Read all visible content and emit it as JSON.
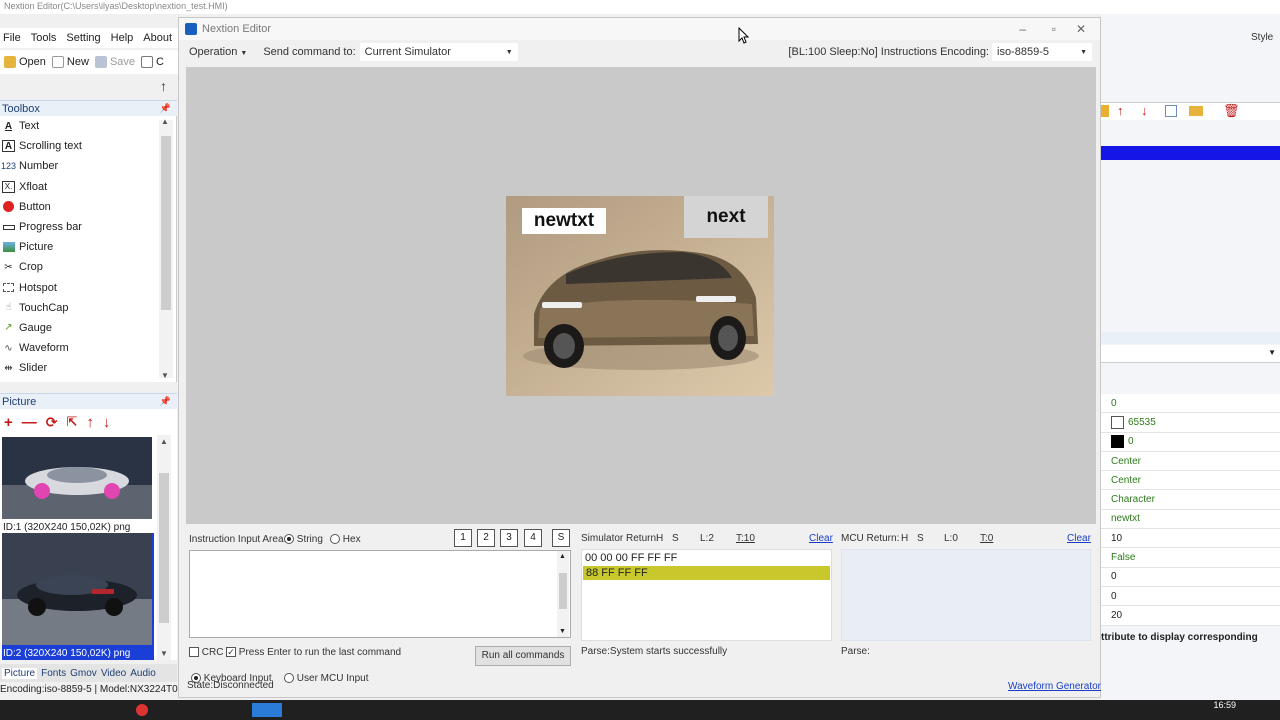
{
  "app_title_bar": {
    "path_text": "Nextion Editor(C:\\Users\\ilyas\\Desktop\\nextion_test.HMI)"
  },
  "main_menu": [
    "File",
    "Tools",
    "Setting",
    "Help",
    "About"
  ],
  "main_toolbar": {
    "open": "Open",
    "new": "New",
    "save": "Save",
    "compile_truncated": "C"
  },
  "toolbox": {
    "title": "Toolbox",
    "items": [
      {
        "label": "Text",
        "icon": "A"
      },
      {
        "label": "Scrolling text",
        "icon": "A"
      },
      {
        "label": "Number",
        "icon": "123"
      },
      {
        "label": "Xfloat",
        "icon": "X.f"
      },
      {
        "label": "Button",
        "icon": "button-icon"
      },
      {
        "label": "Progress bar",
        "icon": "progress-icon"
      },
      {
        "label": "Picture",
        "icon": "picture-icon"
      },
      {
        "label": "Crop",
        "icon": "crop-icon"
      },
      {
        "label": "Hotspot",
        "icon": "hotspot-icon"
      },
      {
        "label": "TouchCap",
        "icon": "touch-icon"
      },
      {
        "label": "Gauge",
        "icon": "gauge-icon"
      },
      {
        "label": "Waveform",
        "icon": "waveform-icon"
      },
      {
        "label": "Slider",
        "icon": "slider-icon"
      }
    ]
  },
  "picture_panel": {
    "title": "Picture",
    "items": [
      {
        "label": "ID:1 (320X240 150,02K) png"
      },
      {
        "label": "ID:2 (320X240 150,02K) png"
      }
    ]
  },
  "bottom_tabs": [
    "Picture",
    "Fonts",
    "Gmov",
    "Video",
    "Audio"
  ],
  "status_left": "Encoding:iso-8859-5 | Model:NX3224T0",
  "right_panel": {
    "style_label": "Style",
    "attribute_values": [
      "0",
      "65535",
      "0",
      "Center",
      "Center",
      "Character",
      "newtxt",
      "10",
      "False",
      "0",
      "0",
      "20"
    ],
    "hint_text": "ttribute to display corresponding"
  },
  "simulator": {
    "title": "Nextion Editor",
    "operation": "Operation",
    "send_command_to": "Send command to:",
    "target": "Current Simulator",
    "info": "[BL:100  Sleep:No] Instructions Encoding:",
    "encoding": "iso-8859-5",
    "screen": {
      "text_component": "newtxt",
      "button_component": "next"
    },
    "instruction_area": {
      "label": "Instruction Input Area:",
      "string_label": "String",
      "hex_label": "Hex",
      "mode": "String",
      "buttons": [
        "1",
        "2",
        "3",
        "4",
        "S"
      ],
      "crc_label": "CRC",
      "crc_checked": false,
      "enter_label": "Press Enter to run the last command",
      "enter_checked": true,
      "run_all": "Run all commands",
      "keyboard_input": "Keyboard Input",
      "user_mcu_input": "User MCU Input",
      "input_mode": "Keyboard Input"
    },
    "simulator_return": {
      "label": "Simulator Return:",
      "h": "H",
      "s": "S",
      "l": "L:2",
      "t": "T:10",
      "clear": "Clear",
      "lines": [
        "00 00 00 FF FF FF",
        "88 FF FF FF"
      ],
      "parse": "Parse:System starts successfully"
    },
    "mcu_return": {
      "label": "MCU Return:",
      "h": "H",
      "s": "S",
      "l": "L:0",
      "t": "T:0",
      "clear": "Clear",
      "parse": "Parse:"
    },
    "waveform_generator": "Waveform Generator",
    "state": "State:Disconnected"
  },
  "taskbar": {
    "clock": "16:59"
  }
}
